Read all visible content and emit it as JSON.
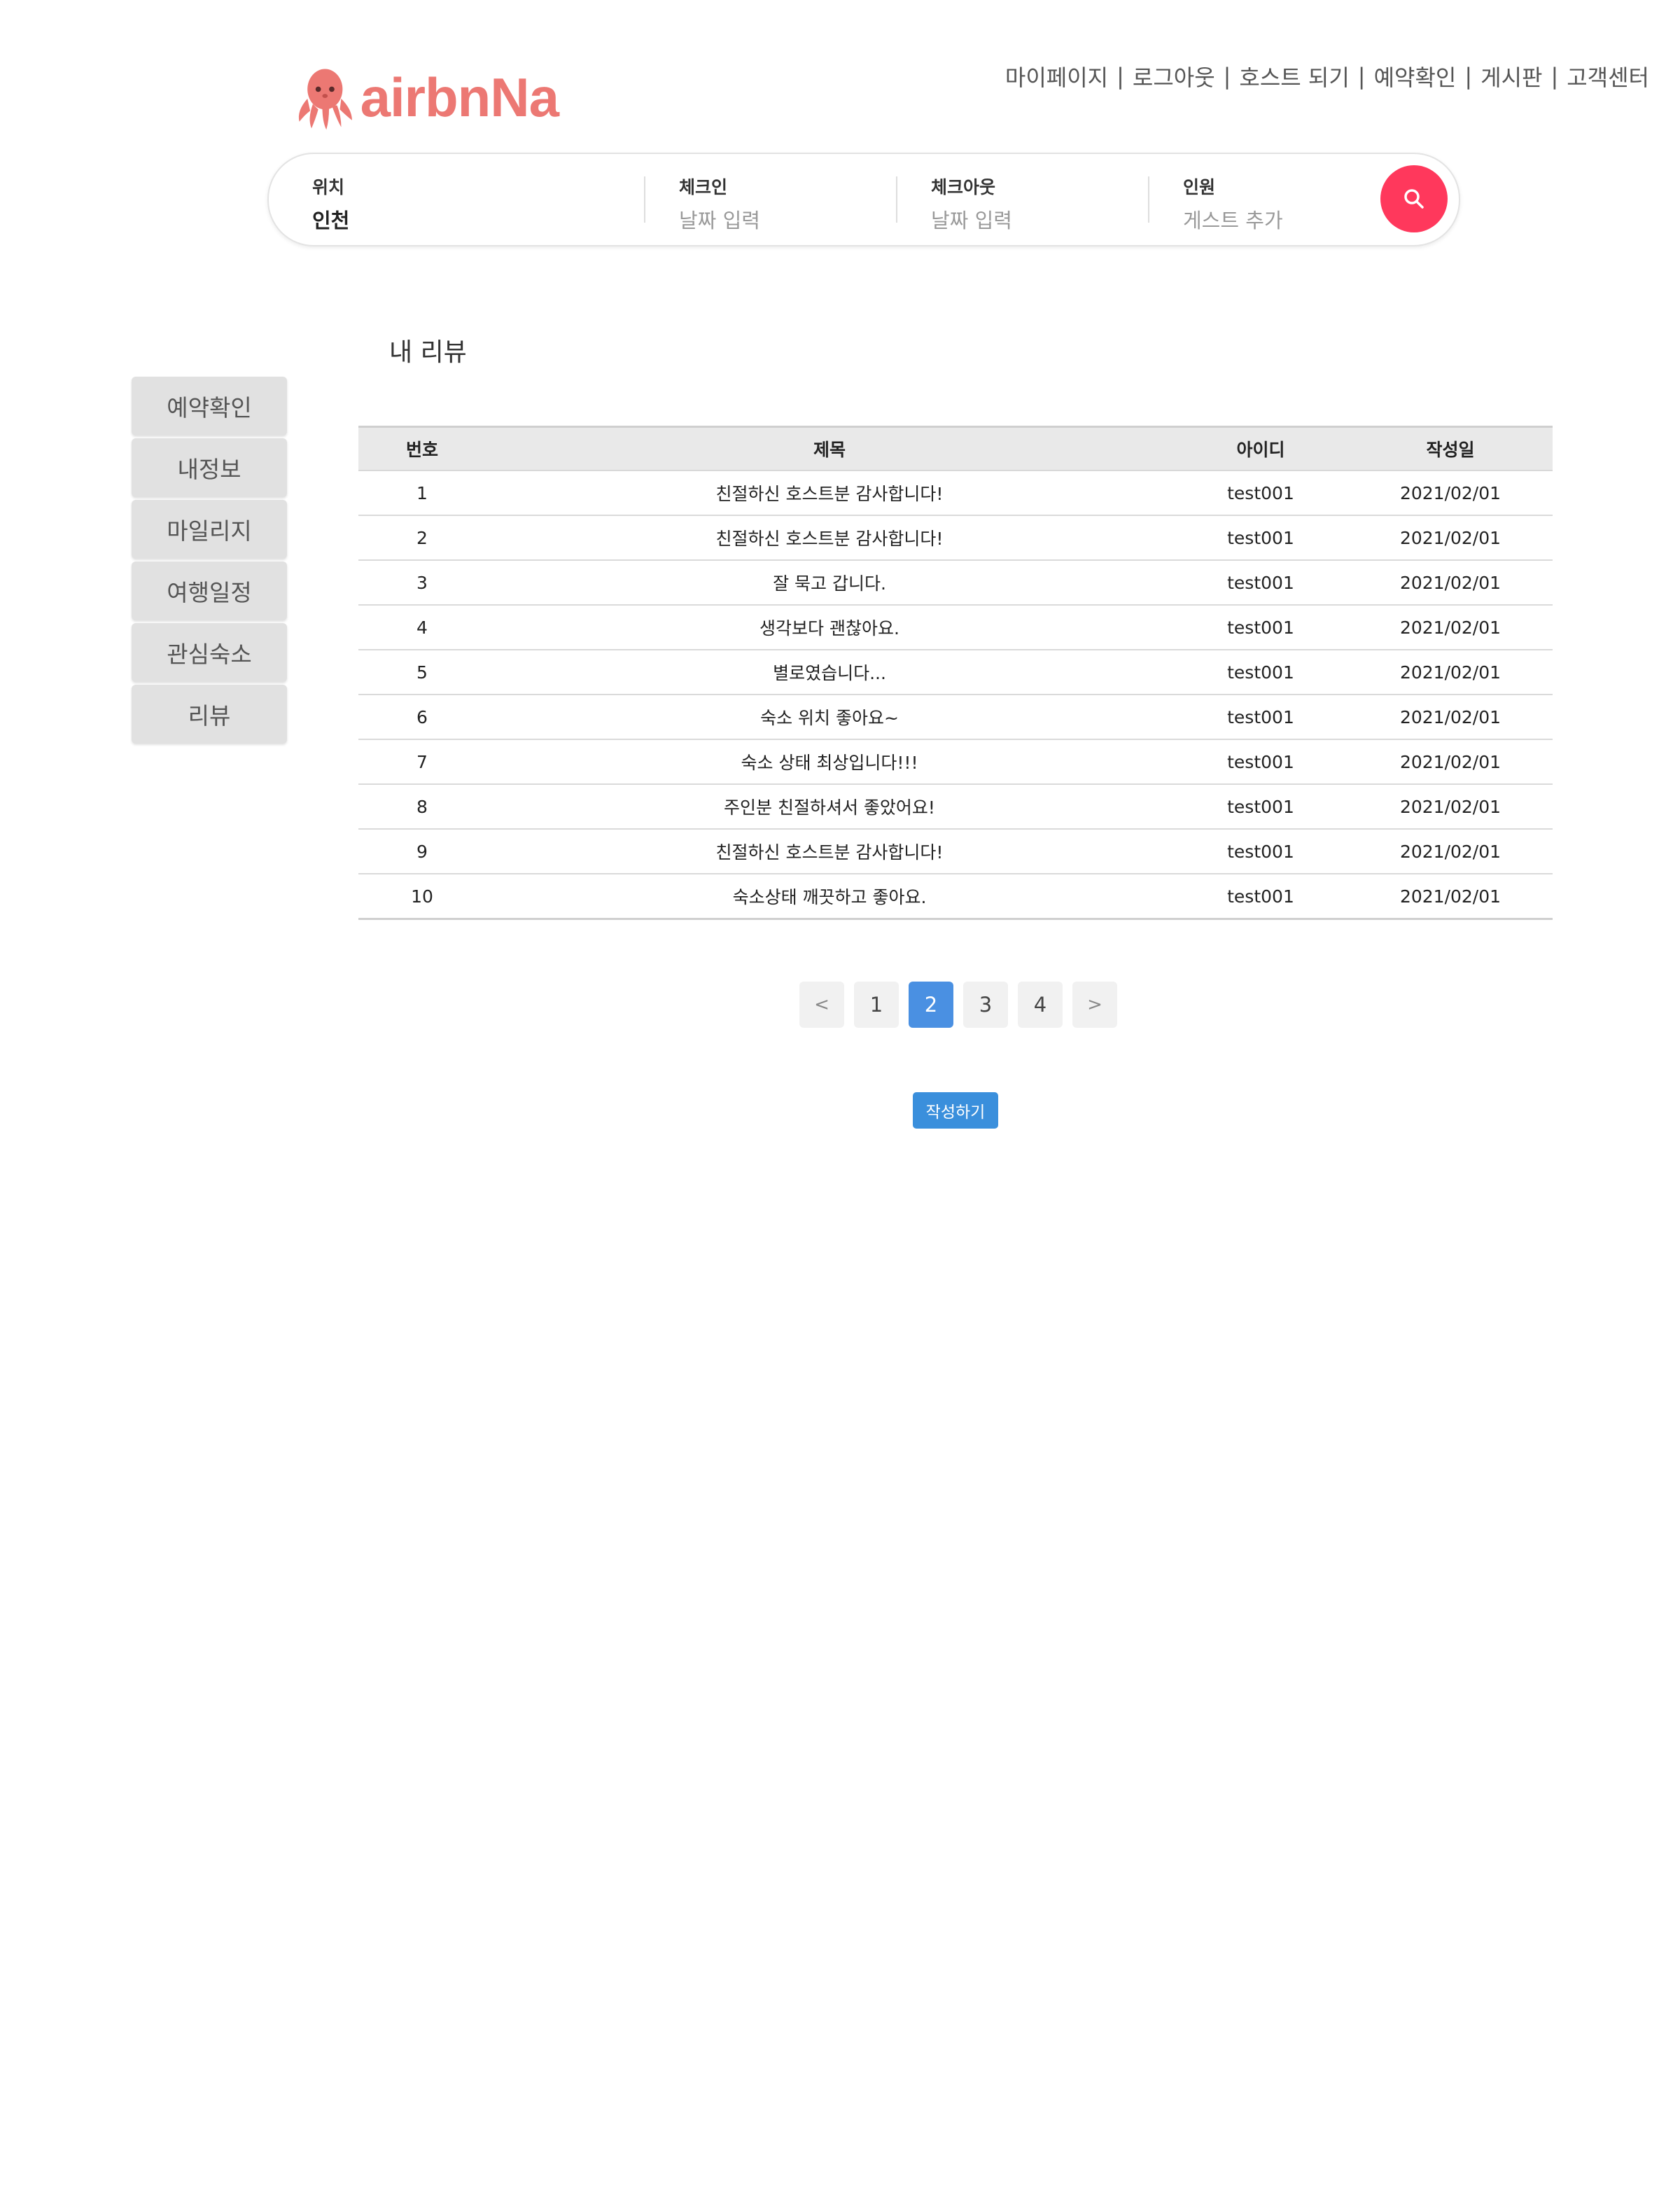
{
  "brand": {
    "name": "airbnNa"
  },
  "topnav": [
    "마이페이지",
    "로그아웃",
    "호스트 되기",
    "예약확인",
    "게시판",
    "고객센터"
  ],
  "search": {
    "location": {
      "label": "위치",
      "value": "인천"
    },
    "checkin": {
      "label": "체크인",
      "placeholder": "날짜 입력"
    },
    "checkout": {
      "label": "체크아웃",
      "placeholder": "날짜 입력"
    },
    "guests": {
      "label": "인원",
      "placeholder": "게스트 추가"
    },
    "button_color": "#ff385c"
  },
  "sidebar": [
    "예약확인",
    "내정보",
    "마일리지",
    "여행일정",
    "관심숙소",
    "리뷰"
  ],
  "page_title": "내 리뷰",
  "table": {
    "headers": [
      "번호",
      "제목",
      "아이디",
      "작성일"
    ],
    "rows": [
      [
        "1",
        "친절하신 호스트분 감사합니다!",
        "test001",
        "2021/02/01"
      ],
      [
        "2",
        "친절하신 호스트분 감사합니다!",
        "test001",
        "2021/02/01"
      ],
      [
        "3",
        "잘 묵고 갑니다.",
        "test001",
        "2021/02/01"
      ],
      [
        "4",
        "생각보다 괜찮아요.",
        "test001",
        "2021/02/01"
      ],
      [
        "5",
        "별로였습니다...",
        "test001",
        "2021/02/01"
      ],
      [
        "6",
        "숙소 위치 좋아요~",
        "test001",
        "2021/02/01"
      ],
      [
        "7",
        "숙소 상태 최상입니다!!!",
        "test001",
        "2021/02/01"
      ],
      [
        "8",
        "주인분 친절하셔서 좋았어요!",
        "test001",
        "2021/02/01"
      ],
      [
        "9",
        "친절하신 호스트분 감사합니다!",
        "test001",
        "2021/02/01"
      ],
      [
        "10",
        "숙소상태 깨끗하고 좋아요.",
        "test001",
        "2021/02/01"
      ]
    ]
  },
  "pagination": {
    "prev": "<",
    "pages": [
      "1",
      "2",
      "3",
      "4"
    ],
    "current": "2",
    "next": ">"
  },
  "write_button": "작성하기",
  "colors": {
    "accent": "#4a90e2",
    "brand": "#ec7873",
    "search": "#ff385c"
  }
}
